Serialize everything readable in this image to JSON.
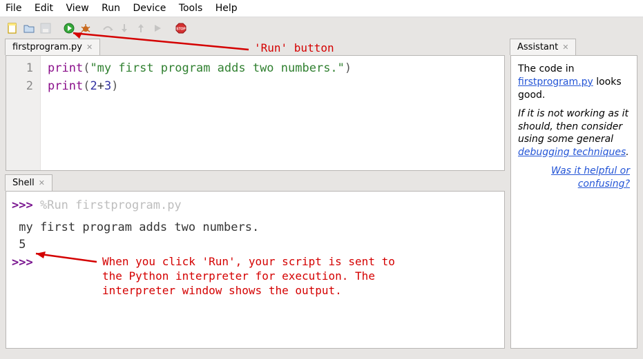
{
  "menubar": [
    "File",
    "Edit",
    "View",
    "Run",
    "Device",
    "Tools",
    "Help"
  ],
  "toolbar": {
    "new": "new-file-icon",
    "open": "open-file-icon",
    "save": "save-icon",
    "run": "run-icon",
    "debug": "debug-icon",
    "step_over": "step-over-icon",
    "step_into": "step-into-icon",
    "step_out": "step-out-icon",
    "resume": "resume-icon",
    "stop": "stop-icon"
  },
  "editor": {
    "tab_label": "firstprogram.py",
    "lines": {
      "n1": "1",
      "n2": "2"
    },
    "line1": {
      "fn": "print",
      "lp": "(",
      "str": "\"my first program adds two numbers.\"",
      "rp": ")"
    },
    "line2": {
      "fn": "print",
      "lp": "(",
      "a": "2",
      "op": "+",
      "b": "3",
      "rp": ")"
    }
  },
  "shell": {
    "tab_label": "Shell",
    "prompt": ">>>",
    "run_cmd": "%Run firstprogram.py",
    "out1": "my first program adds two numbers.",
    "out2": "5"
  },
  "assistant": {
    "tab_label": "Assistant",
    "p1a": "The code in ",
    "p1_link": "firstprogram.py",
    "p1b": " looks good.",
    "p2a": "If it is not working as it should, then consider using some general ",
    "p2_link": "debugging techniques",
    "p2b": ".",
    "helpful": "Was it helpful or confusing?"
  },
  "annotations": {
    "run_label": "'Run' button",
    "shell_note_l1": "When you click 'Run', your script is sent to",
    "shell_note_l2": "the Python interpreter for execution. The",
    "shell_note_l3": "interpreter window shows the output."
  }
}
